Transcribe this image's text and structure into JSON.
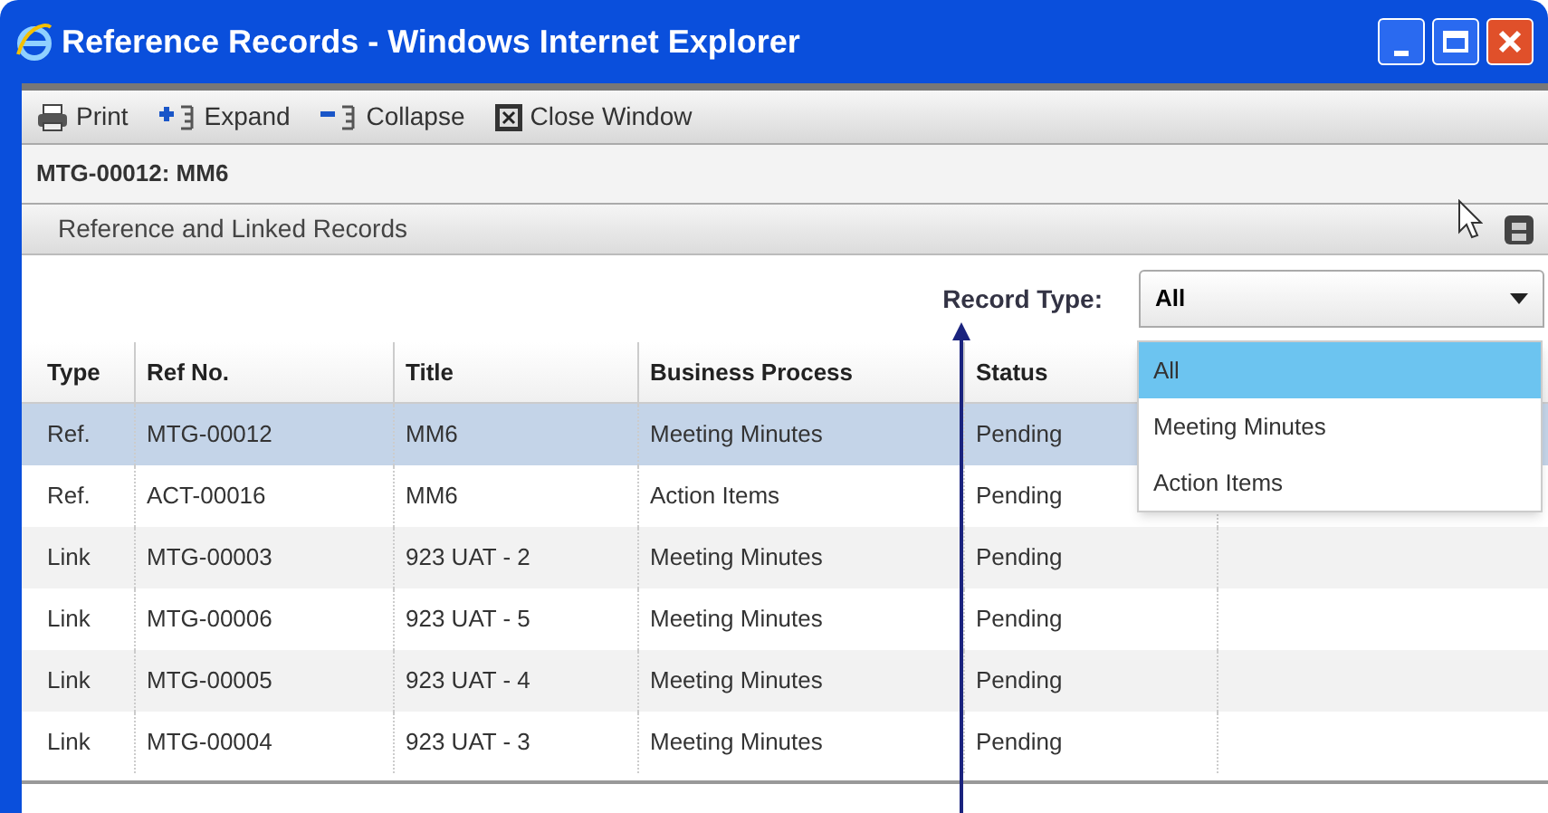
{
  "window": {
    "title": "Reference Records - Windows Internet Explorer"
  },
  "toolbar": [
    {
      "kind": "print",
      "label": "Print"
    },
    {
      "kind": "expand",
      "label": "Expand"
    },
    {
      "kind": "collapse",
      "label": "Collapse"
    },
    {
      "kind": "close",
      "label": "Close Window"
    }
  ],
  "record_title": "MTG-00012: MM6",
  "panel": {
    "title": "Reference and Linked Records"
  },
  "filter": {
    "label": "Record Type:",
    "value": "All",
    "expanded": true,
    "options": [
      {
        "label": "All",
        "selected": true
      },
      {
        "label": "Meeting Minutes",
        "selected": false
      },
      {
        "label": "Action Items",
        "selected": false
      }
    ]
  },
  "table": {
    "columns": [
      "Type",
      "Ref No.",
      "Title",
      "Business Process",
      "Status"
    ],
    "rows": [
      {
        "cells": [
          "Ref.",
          "MTG-00012",
          "MM6",
          "Meeting Minutes",
          "Pending"
        ],
        "selected": true
      },
      {
        "cells": [
          "Ref.",
          "ACT-00016",
          "MM6",
          "Action Items",
          "Pending"
        ],
        "selected": false
      },
      {
        "cells": [
          "Link",
          "MTG-00003",
          "923 UAT - 2",
          "Meeting Minutes",
          "Pending"
        ],
        "selected": false
      },
      {
        "cells": [
          "Link",
          "MTG-00006",
          "923 UAT - 5",
          "Meeting Minutes",
          "Pending"
        ],
        "selected": false
      },
      {
        "cells": [
          "Link",
          "MTG-00005",
          "923 UAT - 4",
          "Meeting Minutes",
          "Pending"
        ],
        "selected": false
      },
      {
        "cells": [
          "Link",
          "MTG-00004",
          "923 UAT - 3",
          "Meeting Minutes",
          "Pending"
        ],
        "selected": false
      }
    ]
  }
}
